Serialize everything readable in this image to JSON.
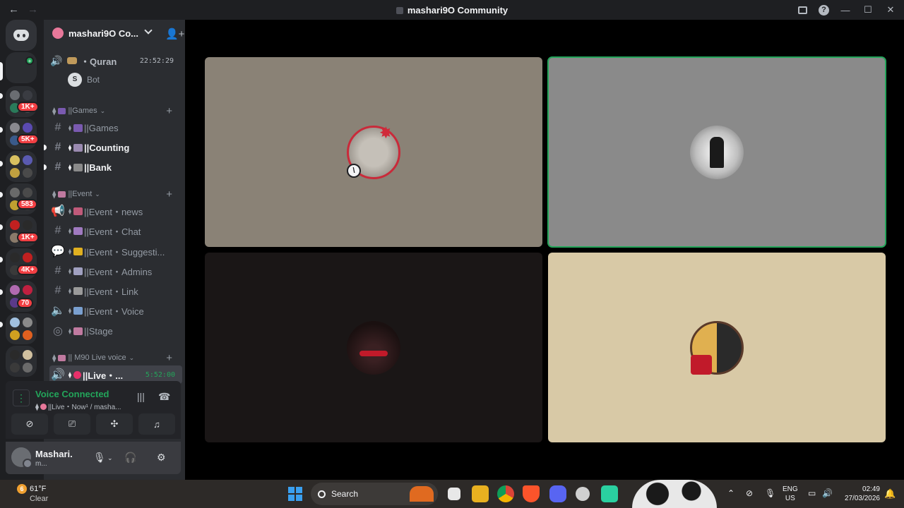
{
  "window": {
    "title": "mashari9O Community",
    "back": "←",
    "forward": "→",
    "controls": [
      "—",
      "☐",
      "✕"
    ]
  },
  "rail": {
    "badges": [
      "1K+",
      "5K+",
      "583",
      "1K+",
      "4K+",
      "70"
    ],
    "dm_badge": "+"
  },
  "server": {
    "name": "mashari9O Co...",
    "invite_icon": "👤+"
  },
  "quran": {
    "label": "・Quran",
    "time": "22:52:29",
    "bot_label": "Bot",
    "bot_avatar": "S"
  },
  "categories": {
    "games": "||Games",
    "event": "||Event",
    "live": "|| M90 Live voice"
  },
  "channels": {
    "games": "||Games",
    "counting": "||Counting",
    "bank": "||Bank",
    "event_news": "||Event・news",
    "event_chat": "||Event・Chat",
    "event_sugg": "||Event・Suggesti...",
    "event_admins": "||Event・Admins",
    "event_link": "||Event・Link",
    "event_voice": "||Event・Voice",
    "stage": "||Stage",
    "live": "||Live・...",
    "live_time": "5:52:00"
  },
  "voice": {
    "status": "Voice Connected",
    "channel": "||Live・Now¹ / masha..."
  },
  "user": {
    "name": "Mashari.",
    "status": "m..."
  },
  "taskbar": {
    "temp": "61°F",
    "condition": "Clear",
    "weather_badge": "6",
    "search": "Search",
    "lang_top": "ENG",
    "lang_bottom": "US",
    "time": "02:49",
    "date": "27/03/2026",
    "tray_arrow": "⌃"
  },
  "colors": {
    "connected": "#23a55a",
    "badge": "#f23f43",
    "speaking_outline": "#23a55a"
  }
}
